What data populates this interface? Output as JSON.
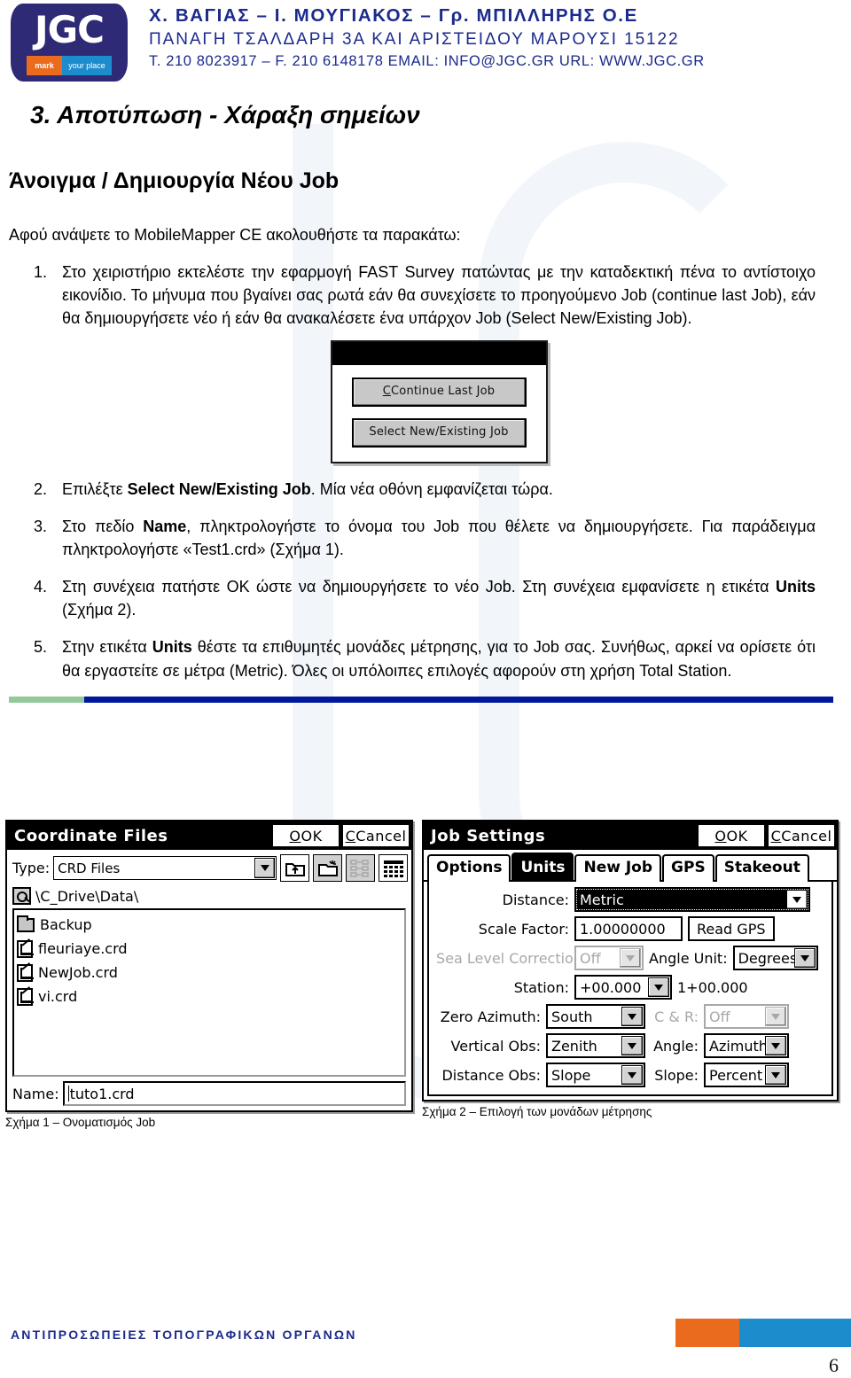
{
  "header": {
    "logo": {
      "brand": "JGC",
      "tag_left": "mark",
      "tag_right": "your place"
    },
    "company_line1": "Χ. ΒΑΓΙΑΣ – Ι. ΜΟΥΓΙΑΚΟΣ – Γρ. ΜΠΙΛΛΗΡΗΣ Ο.Ε",
    "company_line2": "ΠΑΝΑΓΗ ΤΣΑΛΔΑΡΗ 3Α ΚΑΙ ΑΡΙΣΤΕΙΔΟΥ ΜΑΡΟΥΣΙ 15122",
    "company_line3": "Τ. 210 8023917 – F.  210 6148178   EMAIL: INFO@JGC.GR URL: WWW.JGC.GR",
    "brand_blue": "#1b2a8c"
  },
  "document": {
    "section_title": "3. Αποτύπωση - Χάραξη σημείων",
    "sub_title": "Άνοιγμα / Δημιουργία Νέου Job",
    "intro": "Αφού ανάψετε το MobileMapper CE ακολουθήστε τα παρακάτω:",
    "steps": [
      "Στο χειριστήριο εκτελέστε την εφαρμογή FAST Survey πατώντας με την καταδεκτική πένα το αντίστοιχο εικονίδιο. Το μήνυμα που βγαίνει σας ρωτά εάν θα συνεχίσετε το προηγούμενο Job (continue last Job), εάν θα δημιουργήσετε νέο ή εάν θα ανακαλέσετε ένα υπάρχον Job (Select New/Existing Job).",
      "Επιλέξτε Select New/Existing Job. Μία νέα οθόνη εμφανίζεται τώρα.",
      "Στο πεδίο Name, πληκτρολογήστε το όνομα του Job που θέλετε να δημιουργήσετε. Για παράδειγμα πληκτρολογήστε «Test1.crd» (Σχήμα 1).",
      "Στη συνέχεια πατήστε ΟΚ ώστε να δημιουργήσετε το νέο Job. Στη συνέχεια εμφανίσετε η ετικέτα Units (Σχήμα 2).",
      "Στην ετικέτα Units θέστε τα επιθυμητές μονάδες μέτρησης, για το Job σας. Συνήθως, αρκεί να ορίσετε ότι θα εργαστείτε σε μέτρα (Metric). Όλες οι υπόλοιπες επιλογές αφορούν στη χρήση Total Station."
    ],
    "steps_parts": {
      "s1_a": "Στο χειριστήριο εκτελέστε την εφαρμογή FAST Survey πατώντας με την καταδεκτική πένα το αντίστοιχο εικονίδιο. Το μήνυμα που βγαίνει σας ρωτά εάν θα συνεχίσετε το προηγούμενο Job (continue last Job), εάν θα δημιουργήσετε νέο ή εάν θα ανακαλέσετε ένα υπάρχον Job (Select New/Existing Job).",
      "s2_a": "Επιλέξτε ",
      "s2_b": "Select New/Existing Job",
      "s2_c": ". Μία νέα οθόνη εμφανίζεται τώρα.",
      "s3_a": "Στο πεδίο ",
      "s3_b": "Name",
      "s3_c": ", πληκτρολογήστε το όνομα του Job που θέλετε να δημιουργήσετε. Για παράδειγμα πληκτρολογήστε «Test1.crd» (Σχήμα 1).",
      "s4_a": "Στη συνέχεια πατήστε ΟΚ ώστε να δημιουργήσετε το νέο Job. Στη συνέχεια εμφανίσετε η ετικέτα ",
      "s4_b": "Units",
      "s4_c": " (Σχήμα 2).",
      "s5_a": "Στην ετικέτα ",
      "s5_b": "Units",
      "s5_c": " θέστε τα επιθυμητές μονάδες μέτρησης, για το Job σας. Συνήθως, αρκεί να ορίσετε ότι θα εργαστείτε σε μέτρα (Metric). Όλες οι υπόλοιπες επιλογές αφορούν στη χρήση Total Station."
    }
  },
  "ce_dialog": {
    "button_continue": "Continue Last Job",
    "button_select": "Select New/Existing Job"
  },
  "figure1": {
    "title": "Coordinate Files",
    "ok_label": "OK",
    "cancel_label": "Cancel",
    "type_label": "Type:",
    "type_value": "CRD Files",
    "path": "\\C_Drive\\Data\\",
    "files": [
      {
        "name": "Backup",
        "kind": "folder"
      },
      {
        "name": "fleuriaye.crd",
        "kind": "crd"
      },
      {
        "name": "NewJob.crd",
        "kind": "crd"
      },
      {
        "name": "vi.crd",
        "kind": "crd"
      }
    ],
    "name_label": "Name:",
    "name_value": "tuto1.crd",
    "caption": "Σχήμα 1 – Ονοματισμός Job"
  },
  "figure2": {
    "title": "Job Settings",
    "ok_label": "OK",
    "cancel_label": "Cancel",
    "tabs": [
      {
        "label": "Options",
        "active": false
      },
      {
        "label": "Units",
        "active": true
      },
      {
        "label": "New Job",
        "active": false
      },
      {
        "label": "GPS",
        "active": false
      },
      {
        "label": "Stakeout",
        "active": false
      }
    ],
    "fields": {
      "distance_label": "Distance:",
      "distance_value": "Metric",
      "scale_label": "Scale Factor:",
      "scale_value": "1.00000000",
      "read_gps_label": "Read GPS",
      "sea_level_label": "Sea Level Correction:",
      "sea_level_value": "Off",
      "angle_unit_label": "Angle Unit:",
      "angle_unit_value": "Degrees",
      "station_label": "Station:",
      "station_value": "+00.000",
      "station_display": "1+00.000",
      "zero_azimuth_label": "Zero Azimuth:",
      "zero_azimuth_value": "South",
      "cr_label": "C & R:",
      "cr_value": "Off",
      "vertical_obs_label": "Vertical Obs:",
      "vertical_obs_value": "Zenith",
      "angle_label": "Angle:",
      "angle_value": "Azimuth",
      "distance_obs_label": "Distance Obs:",
      "distance_obs_value": "Slope",
      "slope_label": "Slope:",
      "slope_value": "Percent"
    },
    "caption": "Σχήμα 2 – Επιλογή των μονάδων μέτρησης"
  },
  "footer": {
    "text": "ΑΝΤΙΠΡΟΣΩΠΕΙΕΣ ΤΟΠΟΓΡΑΦΙΚΩΝ ΟΡΓΑΝΩΝ",
    "page_number": "6",
    "accent_orange": "#ea6a1e",
    "accent_blue": "#1d8ccd"
  }
}
